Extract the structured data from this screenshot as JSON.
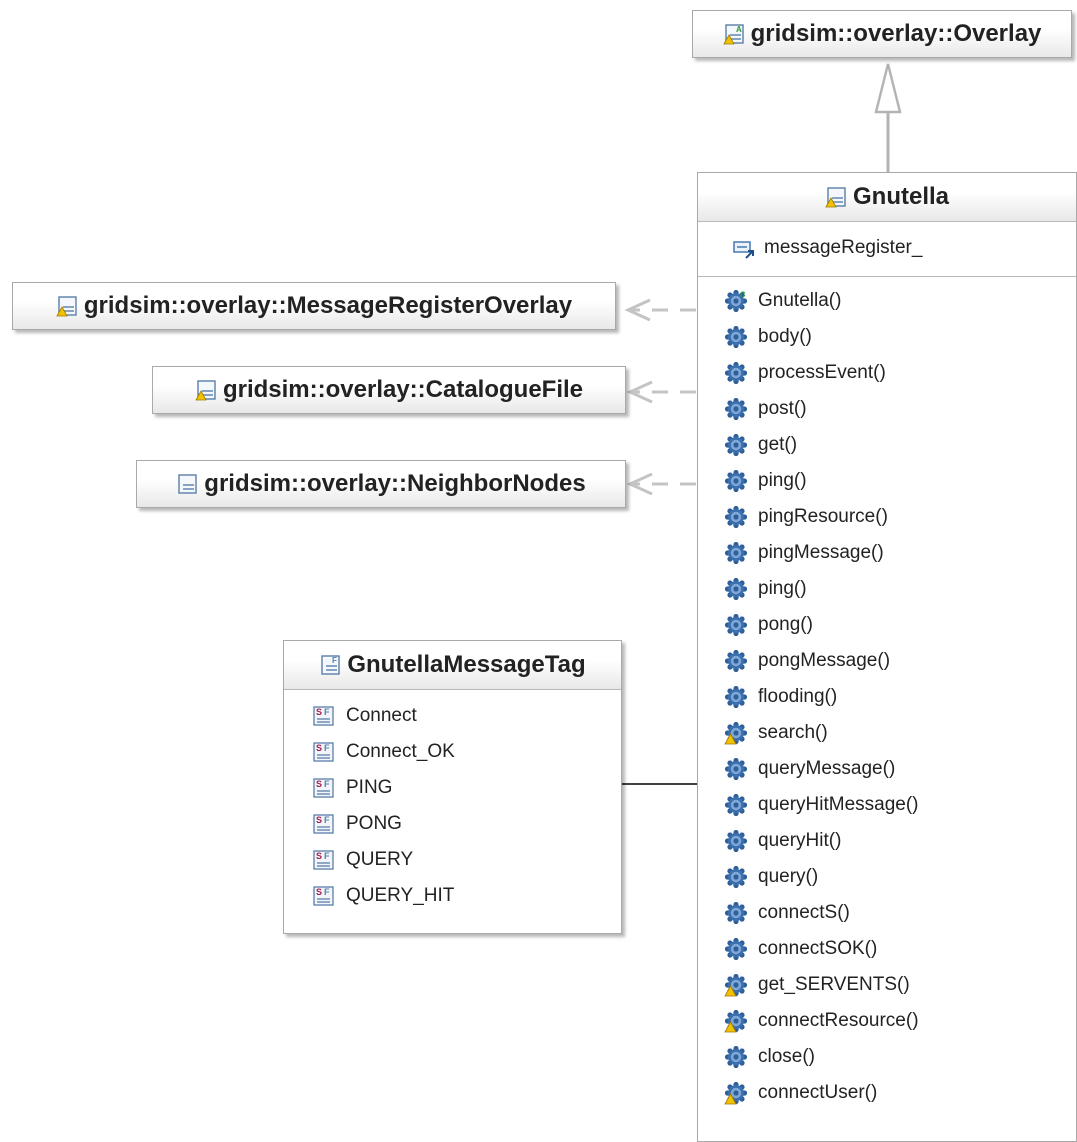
{
  "diagram": {
    "superclass": {
      "name": "gridsim::overlay::Overlay",
      "icon": "abstract-class-icon"
    },
    "main_class": {
      "name": "Gnutella",
      "icon": "class-icon",
      "fields": [
        {
          "name": "messageRegister_",
          "icon": "field-icon"
        }
      ],
      "methods": [
        {
          "name": "Gnutella()",
          "icon": "constructor-icon"
        },
        {
          "name": "body()",
          "icon": "method-icon"
        },
        {
          "name": "processEvent()",
          "icon": "method-icon"
        },
        {
          "name": "post()",
          "icon": "method-icon"
        },
        {
          "name": "get()",
          "icon": "method-icon"
        },
        {
          "name": "ping()",
          "icon": "method-icon"
        },
        {
          "name": "pingResource()",
          "icon": "method-icon"
        },
        {
          "name": "pingMessage()",
          "icon": "method-icon"
        },
        {
          "name": "ping()",
          "icon": "method-icon"
        },
        {
          "name": "pong()",
          "icon": "method-icon"
        },
        {
          "name": "pongMessage()",
          "icon": "method-icon"
        },
        {
          "name": "flooding()",
          "icon": "method-icon"
        },
        {
          "name": "search()",
          "icon": "package-method-icon"
        },
        {
          "name": "queryMessage()",
          "icon": "method-icon"
        },
        {
          "name": "queryHitMessage()",
          "icon": "method-icon"
        },
        {
          "name": "queryHit()",
          "icon": "method-icon"
        },
        {
          "name": "query()",
          "icon": "method-icon"
        },
        {
          "name": "connectS()",
          "icon": "method-icon"
        },
        {
          "name": "connectSOK()",
          "icon": "method-icon"
        },
        {
          "name": "get_SERVENTS()",
          "icon": "package-method-icon"
        },
        {
          "name": "connectResource()",
          "icon": "package-method-icon"
        },
        {
          "name": "close()",
          "icon": "method-icon"
        },
        {
          "name": "connectUser()",
          "icon": "package-method-icon"
        }
      ]
    },
    "dependencies": [
      {
        "name": "gridsim::overlay::MessageRegisterOverlay",
        "icon": "class-icon"
      },
      {
        "name": "gridsim::overlay::CatalogueFile",
        "icon": "class-icon"
      },
      {
        "name": "gridsim::overlay::NeighborNodes",
        "icon": "public-class-icon"
      }
    ],
    "tag_class": {
      "name": "GnutellaMessageTag",
      "icon": "final-class-icon",
      "constants": [
        {
          "name": "Connect",
          "icon": "static-final-field-icon"
        },
        {
          "name": "Connect_OK",
          "icon": "static-final-field-icon"
        },
        {
          "name": "PING",
          "icon": "static-final-field-icon"
        },
        {
          "name": "PONG",
          "icon": "static-final-field-icon"
        },
        {
          "name": "QUERY",
          "icon": "static-final-field-icon"
        },
        {
          "name": "QUERY_HIT",
          "icon": "static-final-field-icon"
        }
      ]
    }
  },
  "colors": {
    "edge": "#b4b4b4",
    "association": "#000000",
    "method_icon": "#2f5f9a",
    "warning": "#e0a800",
    "static_final": "#a01c4a"
  }
}
